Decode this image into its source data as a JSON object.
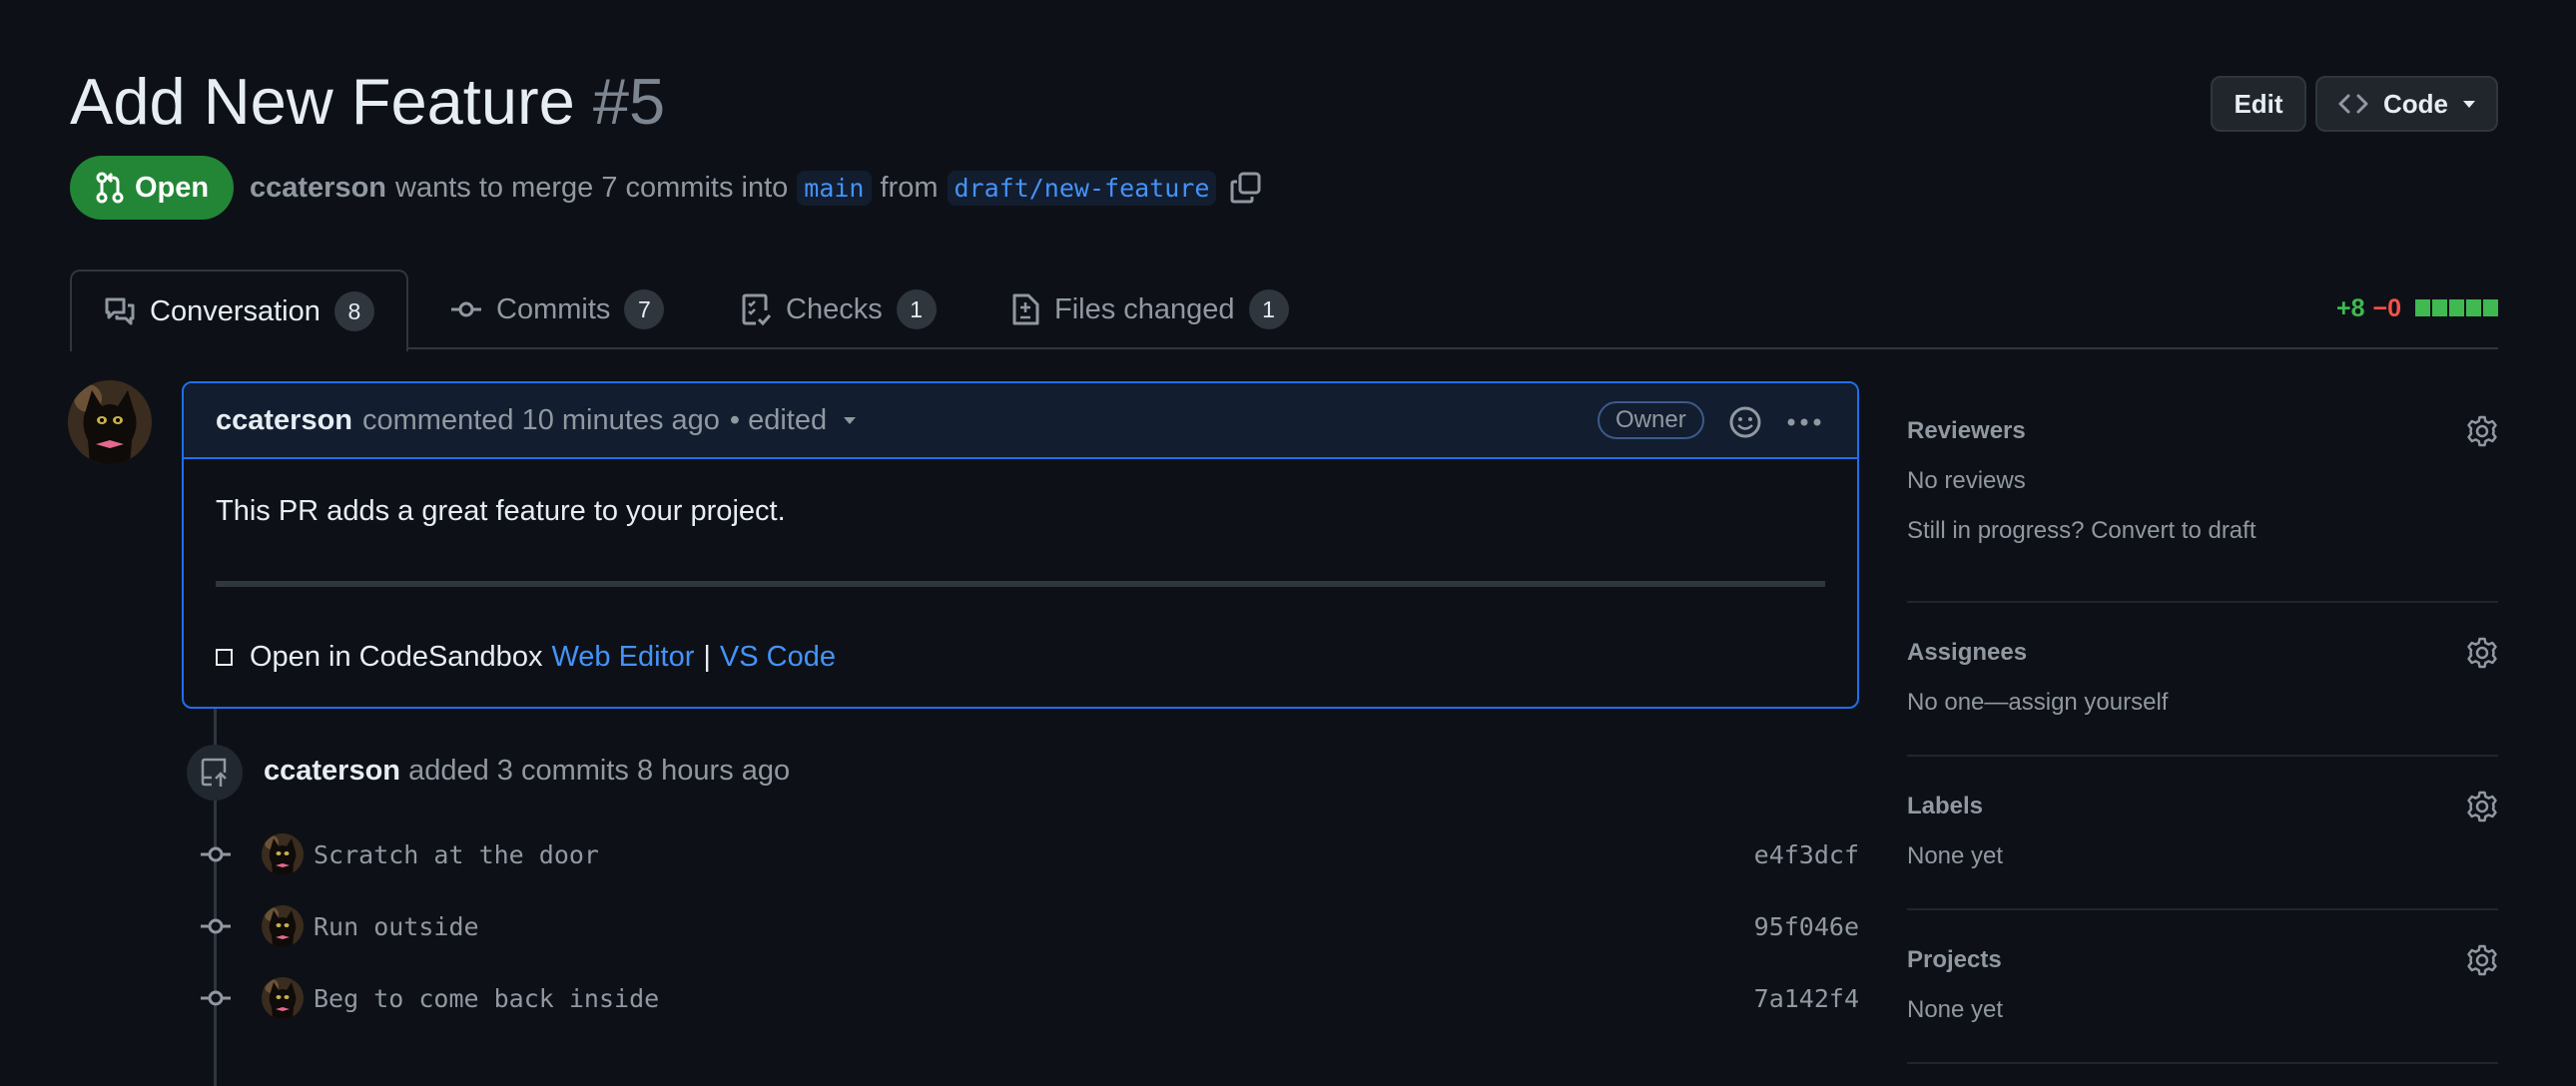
{
  "header": {
    "title": "Add New Feature",
    "number": "#5",
    "edit_label": "Edit",
    "code_label": "Code"
  },
  "state": {
    "badge": "Open",
    "author": "ccaterson",
    "text_mid": "wants to merge 7 commits into",
    "base_branch": "main",
    "text_from": "from",
    "head_branch": "draft/new-feature"
  },
  "tabs": [
    {
      "label": "Conversation",
      "count": "8"
    },
    {
      "label": "Commits",
      "count": "7"
    },
    {
      "label": "Checks",
      "count": "1"
    },
    {
      "label": "Files changed",
      "count": "1"
    }
  ],
  "diffstat": {
    "additions": "+8",
    "deletions": "−0",
    "blocks_added": 5,
    "colors": {
      "add": "#3fb950",
      "del": "#f85149"
    }
  },
  "comment": {
    "author": "ccaterson",
    "meta": "commented 10 minutes ago",
    "edited": "• edited",
    "owner_badge": "Owner",
    "body": "This PR adds a great feature to your project.",
    "sandbox_prefix": "Open in CodeSandbox",
    "web_editor": "Web Editor",
    "separator": "|",
    "vs_code": "VS Code"
  },
  "timeline": {
    "author": "ccaterson",
    "event": "added 3 commits 8 hours ago",
    "commits": [
      {
        "message": "Scratch at the door",
        "sha": "e4f3dcf"
      },
      {
        "message": "Run outside",
        "sha": "95f046e"
      },
      {
        "message": "Beg to come back inside",
        "sha": "7a142f4"
      }
    ]
  },
  "sidebar": {
    "reviewers": {
      "title": "Reviewers",
      "line1": "No reviews",
      "line2": "Still in progress? Convert to draft"
    },
    "assignees": {
      "title": "Assignees",
      "line1": "No one—assign yourself"
    },
    "labels": {
      "title": "Labels",
      "line1": "None yet"
    },
    "projects": {
      "title": "Projects",
      "line1": "None yet"
    }
  },
  "icons": [
    "git-pull-request-icon",
    "copy-icon",
    "comment-discussion-icon",
    "git-commit-icon",
    "checklist-icon",
    "file-diff-icon",
    "smiley-icon",
    "kebab-horizontal-icon",
    "gear-icon",
    "repo-push-icon",
    "code-icon",
    "triangle-down-icon"
  ],
  "colors": {
    "accent": "#1f6feb",
    "open_green": "#238636",
    "link": "#4493f8",
    "bg": "#0d1117"
  }
}
